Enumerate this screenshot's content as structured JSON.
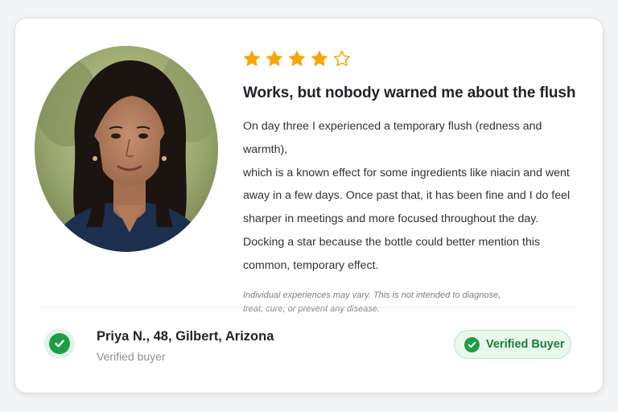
{
  "rating": {
    "value": 4,
    "max": 5,
    "filled_color": "#f6a707",
    "empty_color": "#f6a707"
  },
  "review": {
    "title": "Works, but nobody warned me about the flush",
    "body_lines": [
      "On day three I experienced a temporary flush (redness and warmth),",
      "which is a known effect for some ingredients like niacin and went",
      "away in a few days. Once past that, it has been fine and I do feel",
      "sharper in meetings and more focused throughout the day.",
      "Docking a star because the bottle could better mention this",
      "common, temporary effect."
    ],
    "disclaimer_lines": [
      "Individual experiences may vary. This is not intended to diagnose,",
      "treat, cure, or prevent any disease."
    ]
  },
  "author": {
    "name": "Priya N., 48, Gilbert, Arizona",
    "role": "Verified buyer",
    "avatar_icon": "portrait-photo"
  },
  "badge": {
    "label": "Verified Buyer",
    "icon": "check-circle-icon",
    "accent": "#1e9e44"
  }
}
